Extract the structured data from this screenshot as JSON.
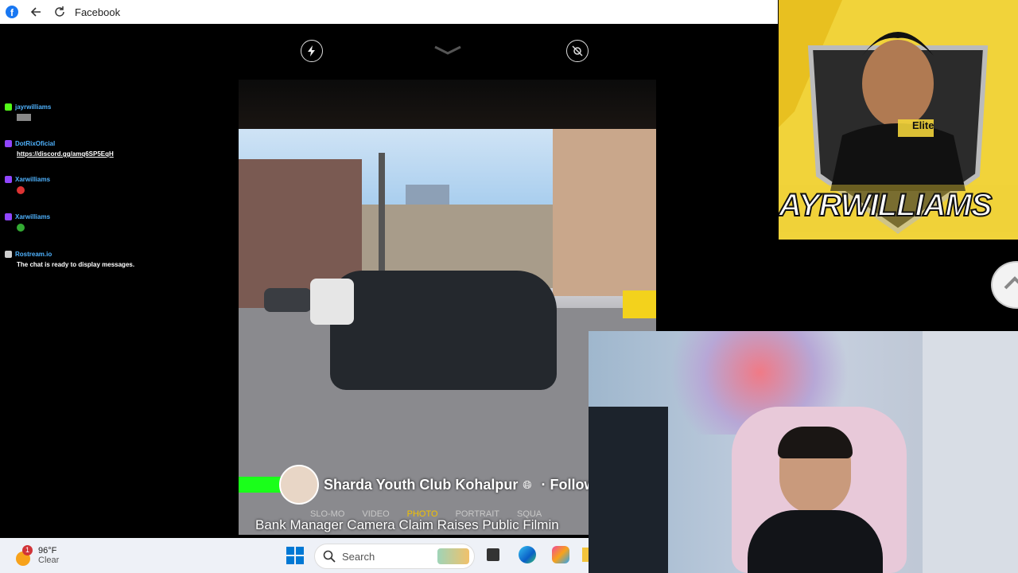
{
  "browser": {
    "title": "Facebook"
  },
  "chat": {
    "messages": [
      {
        "platform": "kick",
        "platform_color": "#53fc18",
        "user": "jayrwilliams",
        "text": ""
      },
      {
        "platform": "twitch",
        "platform_color": "#9146ff",
        "user": "DotRixOficial",
        "text": "https://discord.gg/amq6SP5EqH"
      },
      {
        "platform": "twitch",
        "platform_color": "#9146ff",
        "user": "Xarwilliams",
        "text": ""
      },
      {
        "platform": "twitch",
        "platform_color": "#9146ff",
        "user": "Xarwilliams",
        "text": ""
      },
      {
        "platform": "restream",
        "platform_color": "#cfcfcf",
        "user": "Rostream.io",
        "text": "The chat is ready to display messages."
      }
    ]
  },
  "video": {
    "page_name": "Sharda Youth Club Kohalpur",
    "follow_label": "· Follow",
    "camera_modes": [
      "SLO-MO",
      "VIDEO",
      "PHOTO",
      "PORTRAIT",
      "SQUA"
    ],
    "active_mode": "PHOTO",
    "caption": "Bank Manager Camera Claim Raises Public Filmin"
  },
  "logo": {
    "text": "AYRWILLIAMS",
    "brand": "Elite",
    "accent": "#f1d33a"
  },
  "taskbar": {
    "weather_temp": "96°F",
    "weather_desc": "Clear",
    "weather_badge": "1",
    "search_label": "Search"
  }
}
